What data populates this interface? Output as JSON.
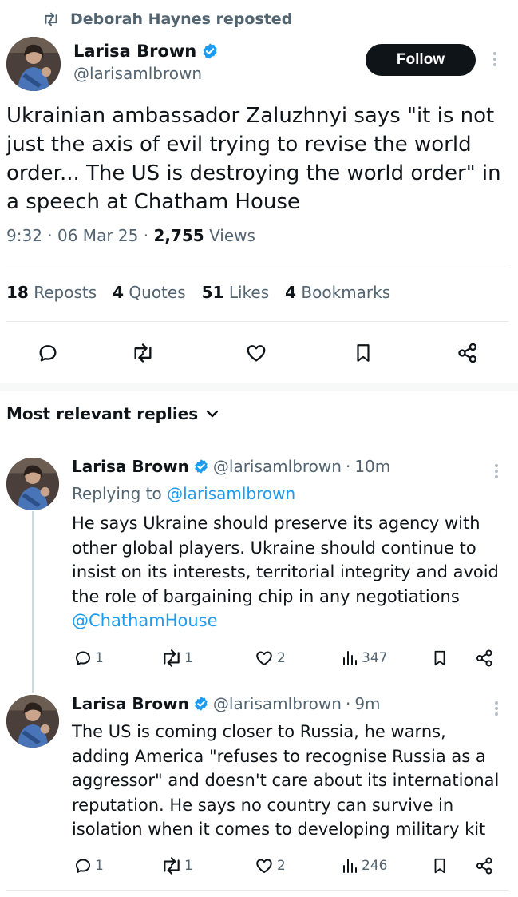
{
  "repost_banner": {
    "text": "Deborah Haynes reposted",
    "icon": "repost-icon"
  },
  "post": {
    "author_name": "Larisa Brown",
    "author_handle": "@larisamlbrown",
    "verified": true,
    "follow_label": "Follow",
    "text": "Ukrainian ambassador Zaluzhnyi says \"it is not just the axis of evil trying to revise the world order... The US is destroying the world order\" in a speech at Chatham House",
    "time": "9:32",
    "date": "06 Mar 25",
    "views_count": "2,755",
    "views_label": "Views",
    "stats": {
      "reposts": {
        "count": "18",
        "label": "Reposts"
      },
      "quotes": {
        "count": "4",
        "label": "Quotes"
      },
      "likes": {
        "count": "51",
        "label": "Likes"
      },
      "bookmarks": {
        "count": "4",
        "label": "Bookmarks"
      }
    },
    "actions": [
      "reply-icon",
      "repost-icon",
      "like-icon",
      "bookmark-icon",
      "share-icon"
    ]
  },
  "replies_section": {
    "title": "Most relevant replies"
  },
  "replies": [
    {
      "author_name": "Larisa Brown",
      "author_handle": "@larisamlbrown",
      "time": "10m",
      "replying_prefix": "Replying to",
      "replying_handle": "@larisamlbrown",
      "text": "He says Ukraine should preserve its agency with other global players. Ukraine should continue to insist on its interests, territorial integrity and avoid the role of bargaining chip in any negotiations",
      "mention": "@ChathamHouse",
      "replies": "1",
      "reposts": "1",
      "likes": "2",
      "views": "347"
    },
    {
      "author_name": "Larisa Brown",
      "author_handle": "@larisamlbrown",
      "time": "9m",
      "text": "The US is coming closer to Russia, he warns, adding America \"refuses to recognise Russia as a aggressor\" and doesn't care about its international reputation. He says no country can survive in isolation when it comes to developing military kit",
      "replies": "1",
      "reposts": "1",
      "likes": "2",
      "views": "246"
    }
  ],
  "colors": {
    "accent": "#1d9bf0",
    "text": "#0f1419",
    "muted": "#536471",
    "button_bg": "#0f1419"
  }
}
